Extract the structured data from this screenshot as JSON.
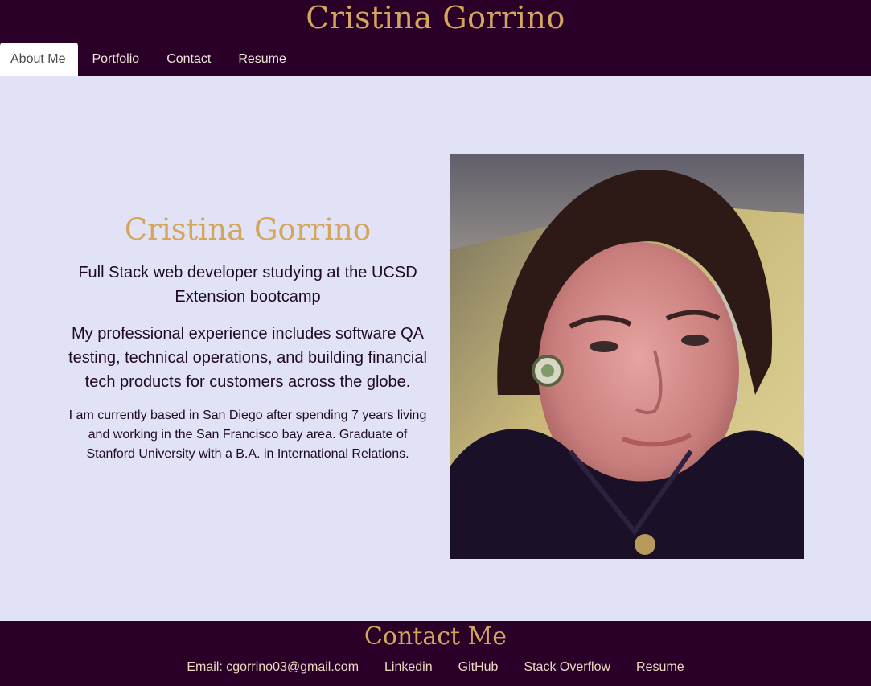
{
  "header": {
    "title": "Cristina Gorrino",
    "nav": [
      {
        "label": "About Me",
        "active": true
      },
      {
        "label": "Portfolio"
      },
      {
        "label": "Contact"
      },
      {
        "label": "Resume"
      }
    ]
  },
  "about": {
    "name": "Cristina Gorrino",
    "lead": "Full Stack web developer studying at the UCSD Extension bootcamp",
    "experience": "My professional experience includes software QA testing, technical operations, and building financial tech products for customers across the globe.",
    "bio": "I am currently based in San Diego after spending 7 years living and working in the San Francisco bay area. Graduate of Stanford University with a B.A. in International Relations."
  },
  "footer": {
    "title": "Contact Me",
    "links": [
      {
        "label": "Email: cgorrino03@gmail.com"
      },
      {
        "label": "Linkedin"
      },
      {
        "label": "GitHub"
      },
      {
        "label": "Stack Overflow"
      },
      {
        "label": "Resume"
      }
    ]
  },
  "colors": {
    "header_bg": "#2a0029",
    "accent_gold": "#d4a65c",
    "page_bg": "#e2e2f7"
  }
}
